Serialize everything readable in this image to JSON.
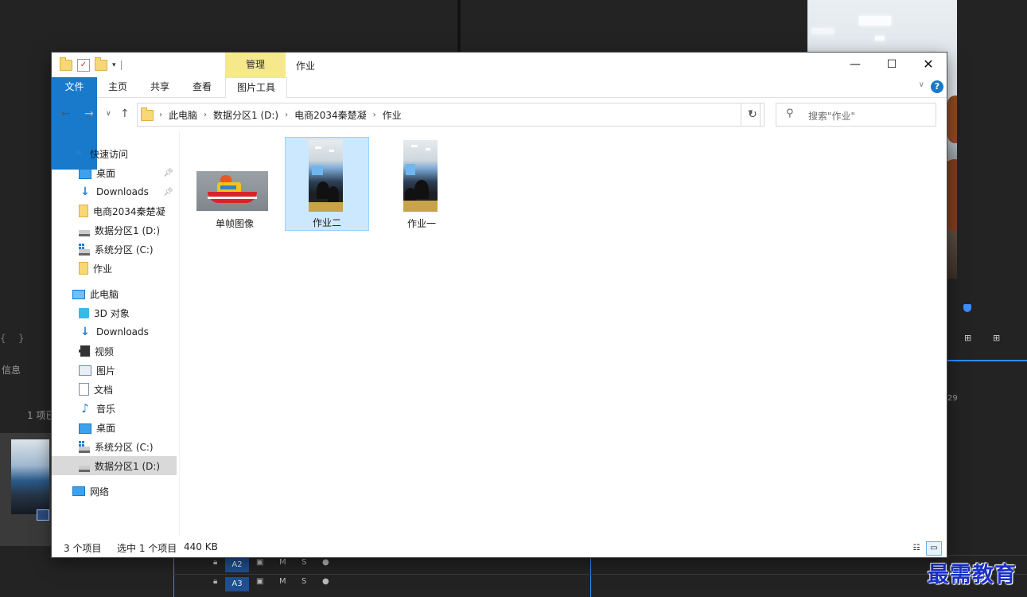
{
  "background_app": {
    "info_label": "信息",
    "items_label": "1 项已",
    "ruler_number": "29",
    "tracks": [
      {
        "label": "A2",
        "m": "M",
        "s": "S"
      },
      {
        "label": "A3",
        "m": "M",
        "s": "S"
      }
    ]
  },
  "watermark": "最需教育",
  "window": {
    "title": "作业",
    "manage_tab": "管理",
    "ribbon_tabs": {
      "file": "文件",
      "home": "主页",
      "share": "共享",
      "view": "查看",
      "picture_tools": "图片工具"
    },
    "help_label": "?",
    "path": [
      "此电脑",
      "数据分区1 (D:)",
      "电商2034秦楚凝",
      "作业"
    ],
    "search_placeholder": "搜索\"作业\"",
    "sidebar": {
      "quick_access": "快速访问",
      "quick_items": [
        {
          "label": "桌面",
          "icon": "desktop-icon",
          "pinned": true
        },
        {
          "label": "Downloads",
          "icon": "download-icon",
          "pinned": true
        },
        {
          "label": "电商2034秦楚凝",
          "icon": "folder-icon"
        },
        {
          "label": "数据分区1 (D:)",
          "icon": "drive-icon"
        },
        {
          "label": "系统分区 (C:)",
          "icon": "system-drive-icon"
        },
        {
          "label": "作业",
          "icon": "folder-icon"
        }
      ],
      "this_pc": "此电脑",
      "pc_items": [
        {
          "label": "3D 对象",
          "icon": "3d-objects-icon"
        },
        {
          "label": "Downloads",
          "icon": "download-icon"
        },
        {
          "label": "视频",
          "icon": "video-icon"
        },
        {
          "label": "图片",
          "icon": "pictures-icon"
        },
        {
          "label": "文档",
          "icon": "documents-icon"
        },
        {
          "label": "音乐",
          "icon": "music-icon"
        },
        {
          "label": "桌面",
          "icon": "desktop-icon"
        },
        {
          "label": "系统分区 (C:)",
          "icon": "system-drive-icon"
        },
        {
          "label": "数据分区1 (D:)",
          "icon": "drive-icon",
          "selected": true
        }
      ],
      "network": "网络"
    },
    "files": [
      {
        "name": "单帧图像",
        "kind": "toy-boat-image"
      },
      {
        "name": "作业二",
        "kind": "classroom-video",
        "selected": true
      },
      {
        "name": "作业一",
        "kind": "classroom-video"
      }
    ],
    "status": {
      "count": "3 个项目",
      "selection": "选中 1 个项目",
      "size": "440 KB"
    }
  },
  "colors": {
    "accent": "#1979ca",
    "selection": "#cce8ff",
    "manage_tab": "#f5e98c",
    "watermark": "#1a2fc8"
  }
}
